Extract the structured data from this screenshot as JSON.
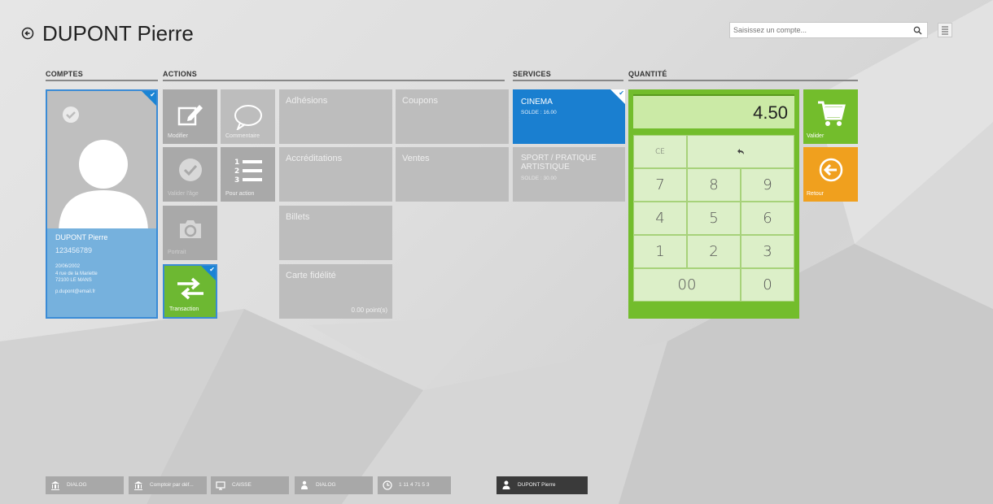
{
  "header": {
    "title": "DUPONT Pierre",
    "search_placeholder": "Saisissez un compte..."
  },
  "sections": {
    "comptes": "COMPTES",
    "actions": "ACTIONS",
    "services": "SERVICES",
    "quantite": "QUANTITÉ"
  },
  "account": {
    "name": "DUPONT Pierre",
    "number": "123456789",
    "birthdate": "20/06/2002",
    "address1": "4 rue de la Mariette",
    "address2": "72100 LE MANS",
    "email": "p.dupont@email.fr"
  },
  "actions": {
    "modifier": "Modifier",
    "commentaire": "Commentaire",
    "valider_age": "Valider l'âge",
    "pour_action": "Pour action",
    "portrait": "Portrait",
    "transaction": "Transaction"
  },
  "categories": {
    "adhesions": "Adhésions",
    "coupons": "Coupons",
    "accreditations": "Accréditations",
    "ventes": "Ventes",
    "billets": "Billets",
    "carte_fidelite": "Carte fidélité",
    "points": "0.00 point(s)"
  },
  "services": [
    {
      "name": "CINEMA",
      "solde": "SOLDE : 16.00",
      "selected": true
    },
    {
      "name": "SPORT / PRATIQUE ARTISTIQUE",
      "solde": "SOLDE : 30.00",
      "selected": false
    }
  ],
  "keypad": {
    "display": "4.50",
    "ce": "CE",
    "k7": "7",
    "k8": "8",
    "k9": "9",
    "k4": "4",
    "k5": "5",
    "k6": "6",
    "k1": "1",
    "k2": "2",
    "k3": "3",
    "k00": "00",
    "k0": "0"
  },
  "side_buttons": {
    "valider": "Valider",
    "retour": "Retour"
  },
  "taskbar": [
    {
      "label": "DIALOG",
      "icon": "bank-icon"
    },
    {
      "label": "Comptoir par déf...",
      "icon": "bank-icon"
    },
    {
      "label": "CAISSE",
      "icon": "monitor-icon"
    },
    {
      "label": "DIALOG",
      "icon": "user-group-icon"
    },
    {
      "label": "1 11 4 71 5 3",
      "icon": "clock-icon"
    },
    {
      "label": "DUPONT Pierre",
      "icon": "user-icon"
    }
  ],
  "colors": {
    "blue_accent": "#1a84d4",
    "green_accent": "#73bd2c",
    "orange_accent": "#f0a01e",
    "tile_gray": "#bdbdbd"
  }
}
